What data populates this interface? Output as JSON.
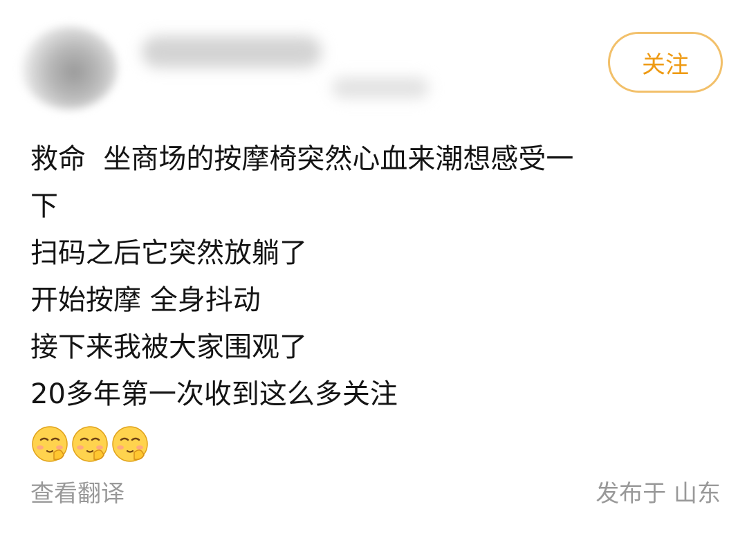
{
  "header": {
    "follow_label": "关注",
    "accent_color": "#ee9a13"
  },
  "post": {
    "lines": [
      "救命  坐商场的按摩椅突然心血来潮想感受一",
      "下",
      "扫码之后它突然放躺了",
      "开始按摩 全身抖动",
      "接下来我被大家围观了",
      "20多年第一次收到这么多关注"
    ],
    "emojis": [
      "shy-face-emoji",
      "shy-face-emoji",
      "shy-face-emoji"
    ]
  },
  "footer": {
    "translate_label": "查看翻译",
    "location_label": "发布于 山东"
  }
}
